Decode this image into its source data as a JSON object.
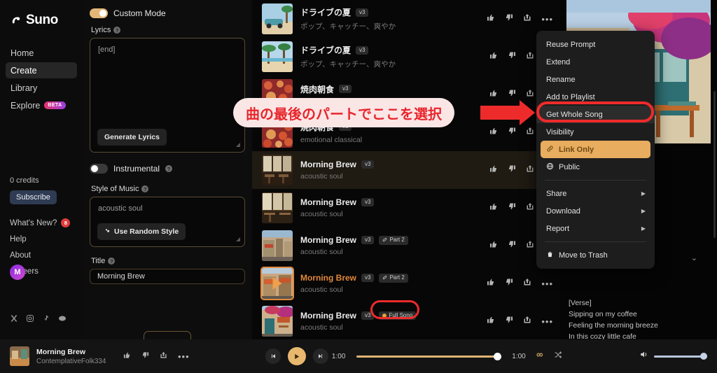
{
  "sidebar": {
    "brand": "Suno",
    "nav": [
      {
        "label": "Home",
        "icon": "home-icon",
        "active": false
      },
      {
        "label": "Create",
        "icon": "create-icon",
        "active": true
      },
      {
        "label": "Library",
        "icon": "library-icon",
        "active": false
      },
      {
        "label": "Explore",
        "icon": "explore-icon",
        "active": false,
        "badge": "BETA"
      }
    ],
    "credits": "0 credits",
    "subscribe_label": "Subscribe",
    "footer": [
      {
        "label": "What's New?",
        "count": "8"
      },
      {
        "label": "Help"
      },
      {
        "label": "About"
      },
      {
        "label": "Careers"
      }
    ],
    "avatar_initial": "M",
    "social_icons": [
      "x-icon",
      "instagram-icon",
      "tiktok-icon",
      "discord-icon"
    ]
  },
  "form": {
    "custom_mode": {
      "label": "Custom Mode",
      "state": "on"
    },
    "lyrics": {
      "label": "Lyrics",
      "value": "[end]",
      "generate_button": "Generate Lyrics"
    },
    "instrumental": {
      "label": "Instrumental",
      "state": "off"
    },
    "style": {
      "label": "Style of Music",
      "value": "acoustic soul",
      "random_button": "Use Random Style"
    },
    "title": {
      "label": "Title",
      "value": "Morning Brew"
    }
  },
  "songs": [
    {
      "title": "ドライブの夏",
      "style": "ポップ、キャッチー、爽やか",
      "version": "v3",
      "extra_tag": "",
      "playing": false,
      "highlight": false,
      "has_more": true,
      "art": "beach-car"
    },
    {
      "title": "ドライブの夏",
      "style": "ポップ、キャッチー、爽やか",
      "version": "v3",
      "extra_tag": "",
      "playing": false,
      "highlight": false,
      "has_more": false,
      "art": "palm-beach"
    },
    {
      "title": "焼肉朝食",
      "style": "emotional classical",
      "version": "v3",
      "extra_tag": "",
      "playing": false,
      "highlight": false,
      "has_more": false,
      "art": "food-flat"
    },
    {
      "title": "焼肉朝食",
      "style": "emotional classical",
      "version": "v3",
      "extra_tag": "",
      "playing": false,
      "highlight": false,
      "has_more": false,
      "art": "food-flat"
    },
    {
      "title": "Morning Brew",
      "style": "acoustic soul",
      "version": "v3",
      "extra_tag": "",
      "playing": false,
      "highlight": true,
      "has_more": false,
      "art": "cafe-interior"
    },
    {
      "title": "Morning Brew",
      "style": "acoustic soul",
      "version": "v3",
      "extra_tag": "",
      "playing": false,
      "highlight": false,
      "has_more": false,
      "art": "cafe-window"
    },
    {
      "title": "Morning Brew",
      "style": "acoustic soul",
      "version": "v3",
      "extra_tag": "Part 2",
      "playing": false,
      "highlight": false,
      "has_more": false,
      "art": "cafe-street"
    },
    {
      "title": "Morning Brew",
      "style": "acoustic soul",
      "version": "v3",
      "extra_tag": "Part 2",
      "playing": true,
      "highlight": false,
      "has_more": true,
      "art": "cafe-awning"
    },
    {
      "title": "Morning Brew",
      "style": "acoustic soul",
      "version": "v3",
      "extra_tag": "Full Song",
      "playing": false,
      "highlight": false,
      "has_more": true,
      "art": "cafe-flowers"
    }
  ],
  "context_menu": {
    "items": [
      {
        "label": "Reuse Prompt",
        "type": "normal"
      },
      {
        "label": "Extend",
        "type": "normal"
      },
      {
        "label": "Rename",
        "type": "normal"
      },
      {
        "label": "Add to Playlist",
        "type": "normal"
      },
      {
        "label": "Get Whole Song",
        "type": "hover"
      },
      {
        "label": "Visibility",
        "type": "section"
      },
      {
        "label": "Link Only",
        "type": "accent",
        "icon": "link-icon"
      },
      {
        "label": "Public",
        "type": "normal",
        "icon": "globe-icon"
      },
      {
        "label": "Share",
        "type": "submenu"
      },
      {
        "label": "Download",
        "type": "submenu"
      },
      {
        "label": "Report",
        "type": "submenu"
      },
      {
        "label": "Move to Trash",
        "type": "danger",
        "icon": "trash-icon"
      }
    ]
  },
  "annotation": {
    "text": "曲の最後のパートでここを選択",
    "highlight_target": "Get Whole Song",
    "secondary_highlight": "Full Song",
    "color": "#ee2b2b"
  },
  "detail": {
    "lyrics": [
      "[Verse]",
      "Sipping on my coffee",
      "Feeling the morning breeze",
      "In this cozy little cafe"
    ]
  },
  "player": {
    "title": "Morning Brew",
    "subtitle": "ContemplativeFolk334",
    "current_time": "1:00",
    "total_time": "1:00",
    "is_playing": true,
    "icons": [
      "thumbs-up-icon",
      "thumbs-down-icon",
      "share-icon",
      "more-icon"
    ],
    "loop_icon": "infinity-icon",
    "shuffle_icon": "shuffle-icon",
    "volume_icon": "volume-icon"
  },
  "colors": {
    "accent": "#e8ad5e",
    "annotation_red": "#ee2b2b",
    "beta_badge": "#e8336d",
    "playing_title": "#e0873a"
  }
}
